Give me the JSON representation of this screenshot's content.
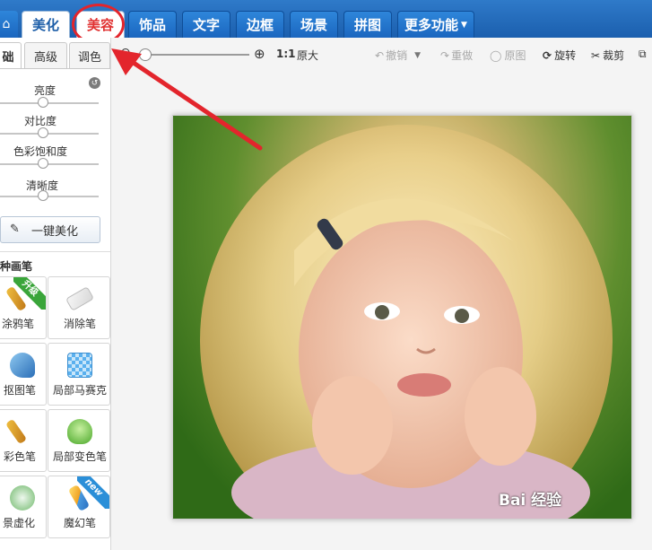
{
  "nav": {
    "home_icon": "home-icon",
    "tabs": [
      {
        "label": "美化"
      },
      {
        "label": "美容"
      },
      {
        "label": "饰品"
      },
      {
        "label": "文字"
      },
      {
        "label": "边框"
      },
      {
        "label": "场景"
      },
      {
        "label": "拼图"
      },
      {
        "label": "更多功能"
      }
    ],
    "active_tab": "美化",
    "highlighted_tab": "美容"
  },
  "toolbar": {
    "ratio_label": "1:1",
    "original_size": "原大",
    "undo": "撤销",
    "redo": "重做",
    "original": "原图",
    "rotate": "旋转",
    "crop": "裁剪"
  },
  "panel": {
    "subtabs": [
      "础",
      "高级",
      "调色"
    ],
    "adjustments": [
      {
        "label": "亮度"
      },
      {
        "label": "对比度"
      },
      {
        "label": "色彩饱和度"
      },
      {
        "label": "清晰度"
      }
    ],
    "one_key_button": "一键美化",
    "section_title": "种画笔",
    "tools": [
      {
        "label": "涂鸦笔",
        "badge": "升级"
      },
      {
        "label": "消除笔",
        "badge": ""
      },
      {
        "label": "抠图笔",
        "badge": ""
      },
      {
        "label": "局部马赛克",
        "badge": ""
      },
      {
        "label": "彩色笔",
        "badge": ""
      },
      {
        "label": "局部变色笔",
        "badge": ""
      },
      {
        "label": "景虚化",
        "badge": ""
      },
      {
        "label": "魔幻笔",
        "badge": "new"
      }
    ]
  },
  "main": {
    "watermark": "Bai 经验"
  },
  "colors": {
    "nav_blue": "#1b5fae",
    "annotation_red": "#e3252c",
    "badge_green": "#3aa53a",
    "badge_blue": "#2b8fd8"
  }
}
